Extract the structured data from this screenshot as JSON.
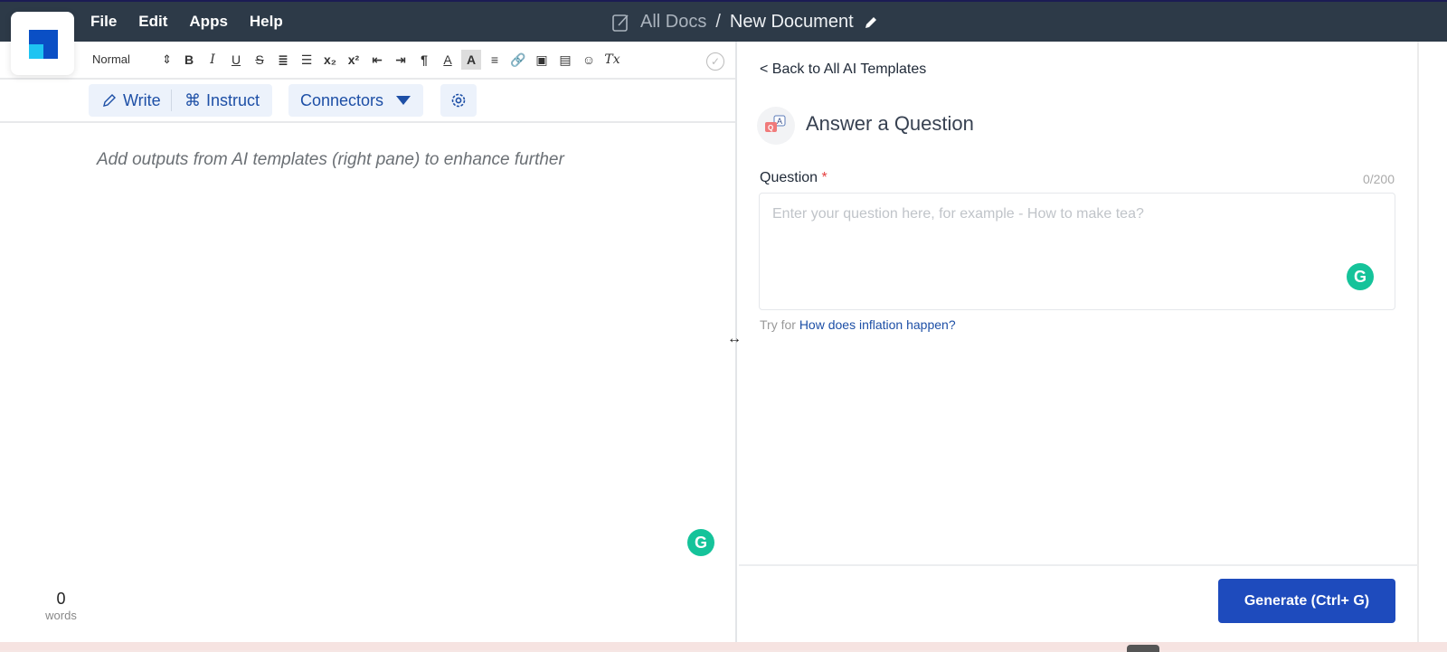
{
  "header": {
    "menu": [
      "File",
      "Edit",
      "Apps",
      "Help"
    ],
    "breadcrumb_root": "All Docs",
    "breadcrumb_sep": "/",
    "document_name": "New Document"
  },
  "toolbar": {
    "format_select": "Normal",
    "format_arrows": "⇕",
    "buttons": [
      "B",
      "I",
      "U",
      "S",
      "≣",
      "☰",
      "x₂",
      "x²",
      "⇤",
      "⇥",
      "¶",
      "A",
      "A",
      "≡",
      "🔗",
      "▣",
      "▤",
      "☺",
      "Tx"
    ],
    "saved_icon": "✓"
  },
  "actions": {
    "write_label": "Write",
    "instruct_label": "Instruct",
    "instruct_icon": "⌘",
    "connectors_label": "Connectors",
    "settings_icon": "gear"
  },
  "editor": {
    "placeholder": "Add outputs from AI templates (right pane) to enhance further",
    "word_count": "0",
    "word_label": "words",
    "grammarly_glyph": "G"
  },
  "right_pane": {
    "back_link": "< Back to All AI Templates",
    "template_title": "Answer a Question",
    "field_label": "Question",
    "required_mark": "*",
    "char_counter": "0/200",
    "field_placeholder": "Enter your question here, for example - How to make tea?",
    "try_prefix": "Try for",
    "try_example": "How does inflation happen?",
    "generate_button": "Generate (Ctrl+ G)"
  },
  "colors": {
    "topbar": "#2d3a48",
    "accent": "#1e4bbd",
    "pill_bg": "#ecf2fb",
    "grammarly": "#15c39a"
  }
}
